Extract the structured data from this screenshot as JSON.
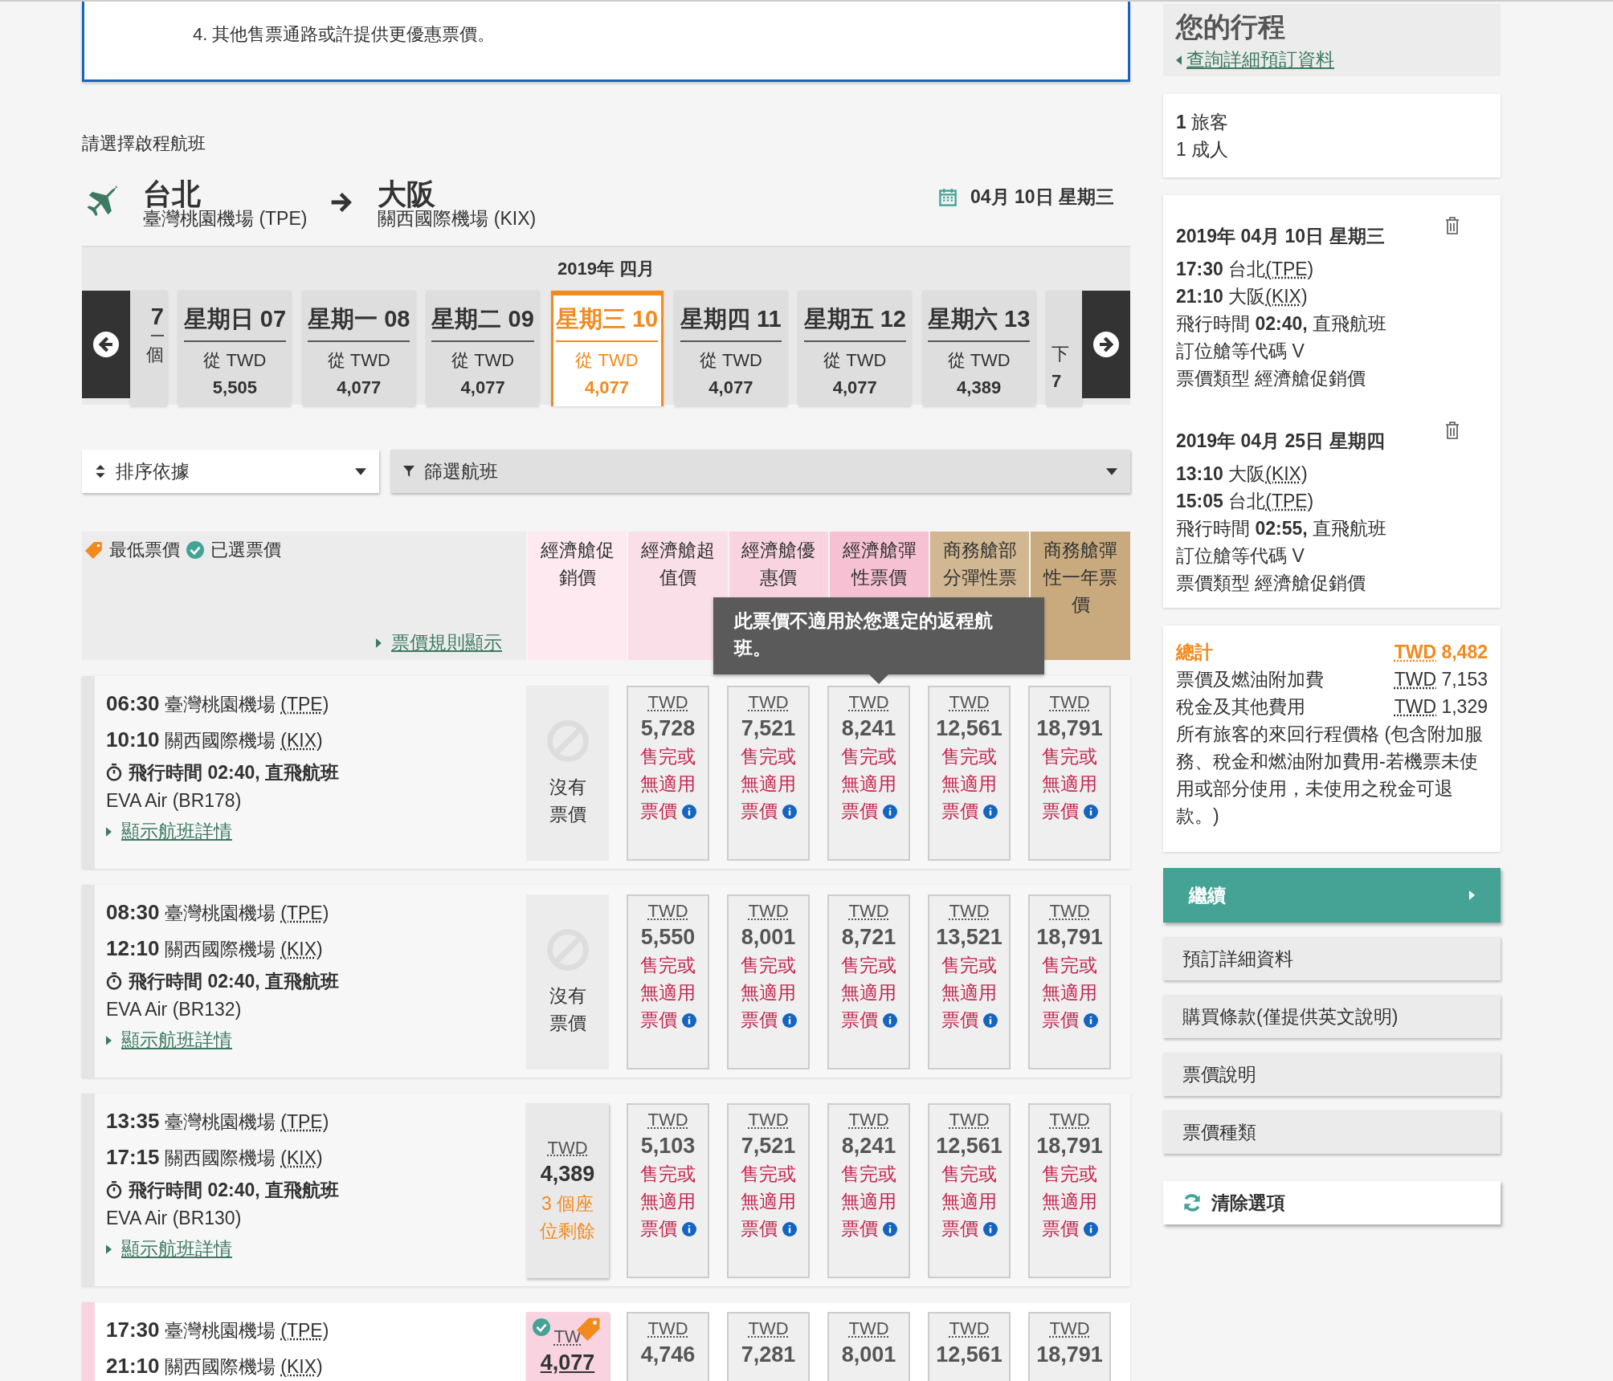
{
  "notice": {
    "text": "4. 其他售票通路或許提供更優惠票價。"
  },
  "heading": "請選擇啟程航班",
  "route": {
    "origin": {
      "city": "台北",
      "airport": "臺灣桃園機場 (TPE)"
    },
    "destination": {
      "city": "大阪",
      "airport": "關西國際機場 (KIX)"
    },
    "date": "04月 10日 星期三"
  },
  "date_strip": {
    "month": "2019年 四月",
    "days": [
      {
        "kind": "partial_left",
        "day": "7",
        "from": "個",
        "selected": false
      },
      {
        "kind": "full",
        "day": "星期日 07",
        "from": "從 TWD",
        "price": "5,505",
        "selected": false
      },
      {
        "kind": "full",
        "day": "星期一 08",
        "from": "從 TWD",
        "price": "4,077",
        "selected": false
      },
      {
        "kind": "full",
        "day": "星期二 09",
        "from": "從 TWD",
        "price": "4,077",
        "selected": false
      },
      {
        "kind": "full",
        "day": "星期三 10",
        "from": "從 TWD",
        "price": "4,077",
        "selected": true
      },
      {
        "kind": "full",
        "day": "星期四 11",
        "from": "從 TWD",
        "price": "4,077",
        "selected": false
      },
      {
        "kind": "full",
        "day": "星期五 12",
        "from": "從 TWD",
        "price": "4,077",
        "selected": false
      },
      {
        "kind": "full",
        "day": "星期六 13",
        "from": "從 TWD",
        "price": "4,389",
        "selected": false
      },
      {
        "kind": "partial_right",
        "from": "下",
        "price": "7",
        "selected": false
      }
    ]
  },
  "sort": {
    "label": "排序依據"
  },
  "filter": {
    "label": "篩選航班"
  },
  "legend": {
    "lowest": "最低票價",
    "selected": "已選票價",
    "rules_link": "票價規則顯示"
  },
  "fare_columns": [
    {
      "label": "經濟艙促銷價",
      "color": "#fde9ef"
    },
    {
      "label": "經濟艙超值價",
      "color": "#fbdfe8"
    },
    {
      "label": "經濟艙優惠價",
      "color": "#f9d4e0"
    },
    {
      "label": "經濟艙彈性票價",
      "color": "#f6c2d3"
    },
    {
      "label": "商務艙部分彈性票",
      "color": "#d2b892"
    },
    {
      "label": "商務艙彈性一年票價",
      "color": "#c8aa7e"
    }
  ],
  "tooltip": {
    "text": "此票價不適用於您選定的返程航班。"
  },
  "flights": [
    {
      "selected": false,
      "departure": {
        "time": "06:30",
        "airport": "臺灣桃園機場",
        "code": "(TPE)"
      },
      "arrival": {
        "time": "10:10",
        "airport": "關西國際機場",
        "code": "(KIX)"
      },
      "duration": "飛行時間 02:40, 直飛航班",
      "airline": "EVA Air (BR178)",
      "details_link": "顯示航班詳情",
      "fares": [
        {
          "kind": "none",
          "label": "沒有票價"
        },
        {
          "kind": "unavailable",
          "currency": "TWD",
          "price": "5,728",
          "status": "售完或無適用票價",
          "selected": false,
          "lowest": false
        },
        {
          "kind": "unavailable",
          "currency": "TWD",
          "price": "7,521",
          "status": "售完或無適用票價",
          "selected": false,
          "lowest": false
        },
        {
          "kind": "unavailable",
          "currency": "TWD",
          "price": "8,241",
          "status": "售完或無適用票價",
          "selected": false,
          "lowest": false
        },
        {
          "kind": "unavailable",
          "currency": "TWD",
          "price": "12,561",
          "status": "售完或無適用票價",
          "selected": false,
          "lowest": false
        },
        {
          "kind": "unavailable",
          "currency": "TWD",
          "price": "18,791",
          "status": "售完或無適用票價",
          "selected": false,
          "lowest": false
        }
      ]
    },
    {
      "selected": false,
      "departure": {
        "time": "08:30",
        "airport": "臺灣桃園機場",
        "code": "(TPE)"
      },
      "arrival": {
        "time": "12:10",
        "airport": "關西國際機場",
        "code": "(KIX)"
      },
      "duration": "飛行時間 02:40, 直飛航班",
      "airline": "EVA Air (BR132)",
      "details_link": "顯示航班詳情",
      "fares": [
        {
          "kind": "none",
          "label": "沒有票價"
        },
        {
          "kind": "unavailable",
          "currency": "TWD",
          "price": "5,550",
          "status": "售完或無適用票價",
          "selected": false,
          "lowest": false
        },
        {
          "kind": "unavailable",
          "currency": "TWD",
          "price": "8,001",
          "status": "售完或無適用票價",
          "selected": false,
          "lowest": false
        },
        {
          "kind": "unavailable",
          "currency": "TWD",
          "price": "8,721",
          "status": "售完或無適用票價",
          "selected": false,
          "lowest": false
        },
        {
          "kind": "unavailable",
          "currency": "TWD",
          "price": "13,521",
          "status": "售完或無適用票價",
          "selected": false,
          "lowest": false
        },
        {
          "kind": "unavailable",
          "currency": "TWD",
          "price": "18,791",
          "status": "售完或無適用票價",
          "selected": false,
          "lowest": false
        }
      ]
    },
    {
      "selected": false,
      "departure": {
        "time": "13:35",
        "airport": "臺灣桃園機場",
        "code": "(TPE)"
      },
      "arrival": {
        "time": "17:15",
        "airport": "關西國際機場",
        "code": "(KIX)"
      },
      "duration": "飛行時間 02:40, 直飛航班",
      "airline": "EVA Air (BR130)",
      "details_link": "顯示航班詳情",
      "fares": [
        {
          "kind": "available",
          "currency": "TWD",
          "price": "4,389",
          "seats": "3 個座位剩餘",
          "selected": false,
          "lowest": false
        },
        {
          "kind": "unavailable",
          "currency": "TWD",
          "price": "5,103",
          "status": "售完或無適用票價",
          "selected": false,
          "lowest": false
        },
        {
          "kind": "unavailable",
          "currency": "TWD",
          "price": "7,521",
          "status": "售完或無適用票價",
          "selected": false,
          "lowest": false
        },
        {
          "kind": "unavailable",
          "currency": "TWD",
          "price": "8,241",
          "status": "售完或無適用票價",
          "selected": false,
          "lowest": false
        },
        {
          "kind": "unavailable",
          "currency": "TWD",
          "price": "12,561",
          "status": "售完或無適用票價",
          "selected": false,
          "lowest": false
        },
        {
          "kind": "unavailable",
          "currency": "TWD",
          "price": "18,791",
          "status": "售完或無適用票價",
          "selected": false,
          "lowest": false
        }
      ]
    },
    {
      "selected": true,
      "departure": {
        "time": "17:30",
        "airport": "臺灣桃園機場",
        "code": "(TPE)"
      },
      "arrival": {
        "time": "21:10",
        "airport": "關西國際機場",
        "code": "(KIX)"
      },
      "fares": [
        {
          "kind": "available",
          "currency": "TW",
          "price": "4,077",
          "selected": true,
          "lowest": true
        },
        {
          "kind": "unavailable",
          "currency": "TWD",
          "price": "4,746",
          "selected": false,
          "lowest": false
        },
        {
          "kind": "unavailable",
          "currency": "TWD",
          "price": "7,281",
          "selected": false,
          "lowest": false
        },
        {
          "kind": "unavailable",
          "currency": "TWD",
          "price": "8,001",
          "selected": false,
          "lowest": false
        },
        {
          "kind": "unavailable",
          "currency": "TWD",
          "price": "12,561",
          "selected": false,
          "lowest": false
        },
        {
          "kind": "unavailable",
          "currency": "TWD",
          "price": "18,791",
          "selected": false,
          "lowest": false
        }
      ]
    }
  ],
  "sidebar": {
    "title": "您的行程",
    "link": "查詢詳細預訂資料",
    "passengers": {
      "count": "**1** 旅客",
      "detail": "1 成人"
    },
    "segments": [
      {
        "date": "2019年 04月 10日 星期三",
        "departure": {
          "time": "17:30",
          "place": "台北",
          "code": "(TPE)"
        },
        "arrival": {
          "time": "21:10",
          "place": "大阪",
          "code": "(KIX)"
        },
        "duration": "飛行時間 **02:40,** 直飛航班",
        "booking_class": "訂位艙等代碼 V",
        "fare_type": "票價類型 經濟艙促銷價"
      },
      {
        "date": "2019年 04月 25日 星期四",
        "departure": {
          "time": "13:10",
          "place": "大阪",
          "code": "(KIX)"
        },
        "arrival": {
          "time": "15:05",
          "place": "台北",
          "code": "(TPE)"
        },
        "duration": "飛行時間 **02:55,** 直飛航班",
        "booking_class": "訂位艙等代碼 V",
        "fare_type": "票價類型 經濟艙促銷價"
      }
    ],
    "totals": {
      "label": "總計",
      "currency": "TWD",
      "amount": "8,482",
      "lines": [
        {
          "label": "票價及燃油附加費",
          "currency": "TWD",
          "amount": "7,153"
        },
        {
          "label": "稅金及其他費用",
          "currency": "TWD",
          "amount": "1,329"
        }
      ],
      "note": "所有旅客的來回行程價格 (包含附加服務、稅金和燃油附加費用-若機票未使用或部分使用，未使用之稅金可退款。)"
    },
    "continue": {
      "label": "繼續"
    },
    "links": [
      "預訂詳細資料",
      "購買條款(僅提供英文說明)",
      "票價說明",
      "票價種類"
    ],
    "clear": {
      "label": "清除選項"
    }
  }
}
